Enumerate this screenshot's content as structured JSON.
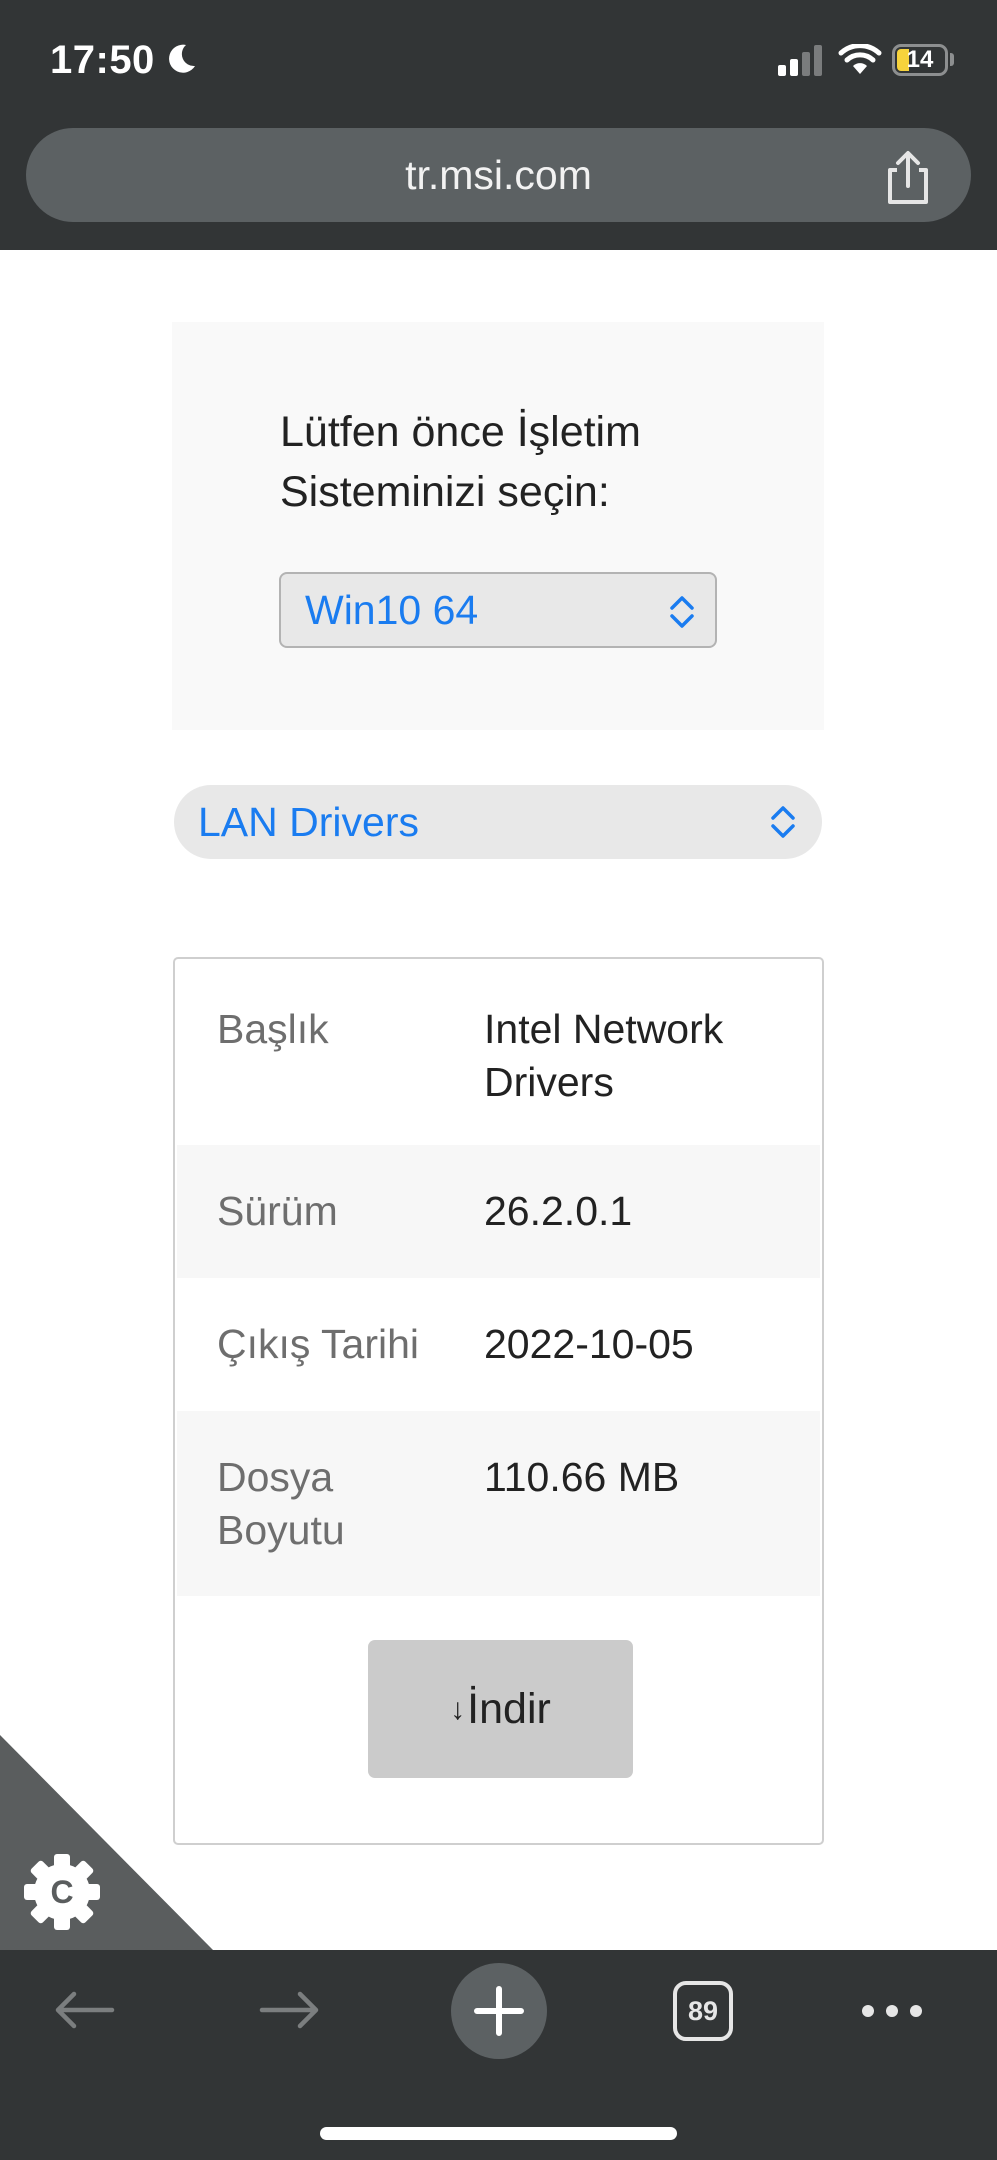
{
  "status_bar": {
    "time": "17:50",
    "battery_level": "14",
    "icons": [
      "moon-icon",
      "signal-icon",
      "wifi-icon",
      "battery-icon"
    ]
  },
  "browser": {
    "url": "tr.msi.com",
    "share_icon": "share-icon",
    "tab_count": "89",
    "toolbar_icons": [
      "back-arrow-icon",
      "forward-arrow-icon",
      "new-tab-plus-icon",
      "tabs-icon",
      "more-dots-icon"
    ]
  },
  "page": {
    "os_prompt": "Lütfen önce İşletim Sisteminizi seçin:",
    "os_select": {
      "value": "Win10 64"
    },
    "category_select": {
      "value": "LAN Drivers"
    },
    "driver_info": {
      "rows": [
        {
          "label": "Başlık",
          "value": "Intel Network Drivers"
        },
        {
          "label": "Sürüm",
          "value": "26.2.0.1"
        },
        {
          "label": "Çıkış Tarihi",
          "value": "2022-10-05"
        },
        {
          "label": "Dosya Boyutu",
          "value": "110.66 MB"
        }
      ],
      "download_label": "İndir",
      "download_icon": "download-arrow-icon"
    }
  },
  "corner_badge": {
    "icon": "gear-badge-icon",
    "letter": "C"
  },
  "colors": {
    "chrome_bg": "#323536",
    "url_bar_bg": "#5c6163",
    "link_blue": "#1a7cf0",
    "select_bg": "#e8e8e8",
    "button_bg": "#cbcbcb",
    "battery_low": "#f7d33c"
  }
}
